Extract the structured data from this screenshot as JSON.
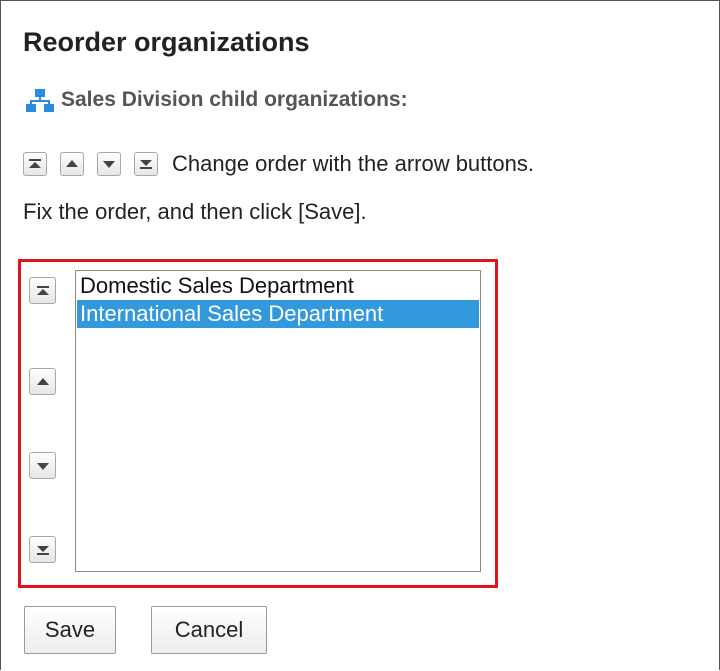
{
  "page": {
    "title": "Reorder organizations",
    "subtitle": "Sales Division child organizations:",
    "instruction_line1": "Change order with the arrow buttons.",
    "instruction_line2": "Fix the order, and then click [Save]."
  },
  "icons": {
    "org": "org-chart-icon",
    "move_top": "move-to-top-icon",
    "move_up": "move-up-icon",
    "move_down": "move-down-icon",
    "move_bottom": "move-to-bottom-icon"
  },
  "organizations": {
    "options": [
      {
        "label": "Domestic Sales Department",
        "selected": false
      },
      {
        "label": "International Sales Department",
        "selected": true
      }
    ]
  },
  "actions": {
    "save_label": "Save",
    "cancel_label": "Cancel"
  },
  "colors": {
    "highlight_border": "#e0141d",
    "selection": "#3399dd",
    "org_icon": "#2a8be0"
  }
}
